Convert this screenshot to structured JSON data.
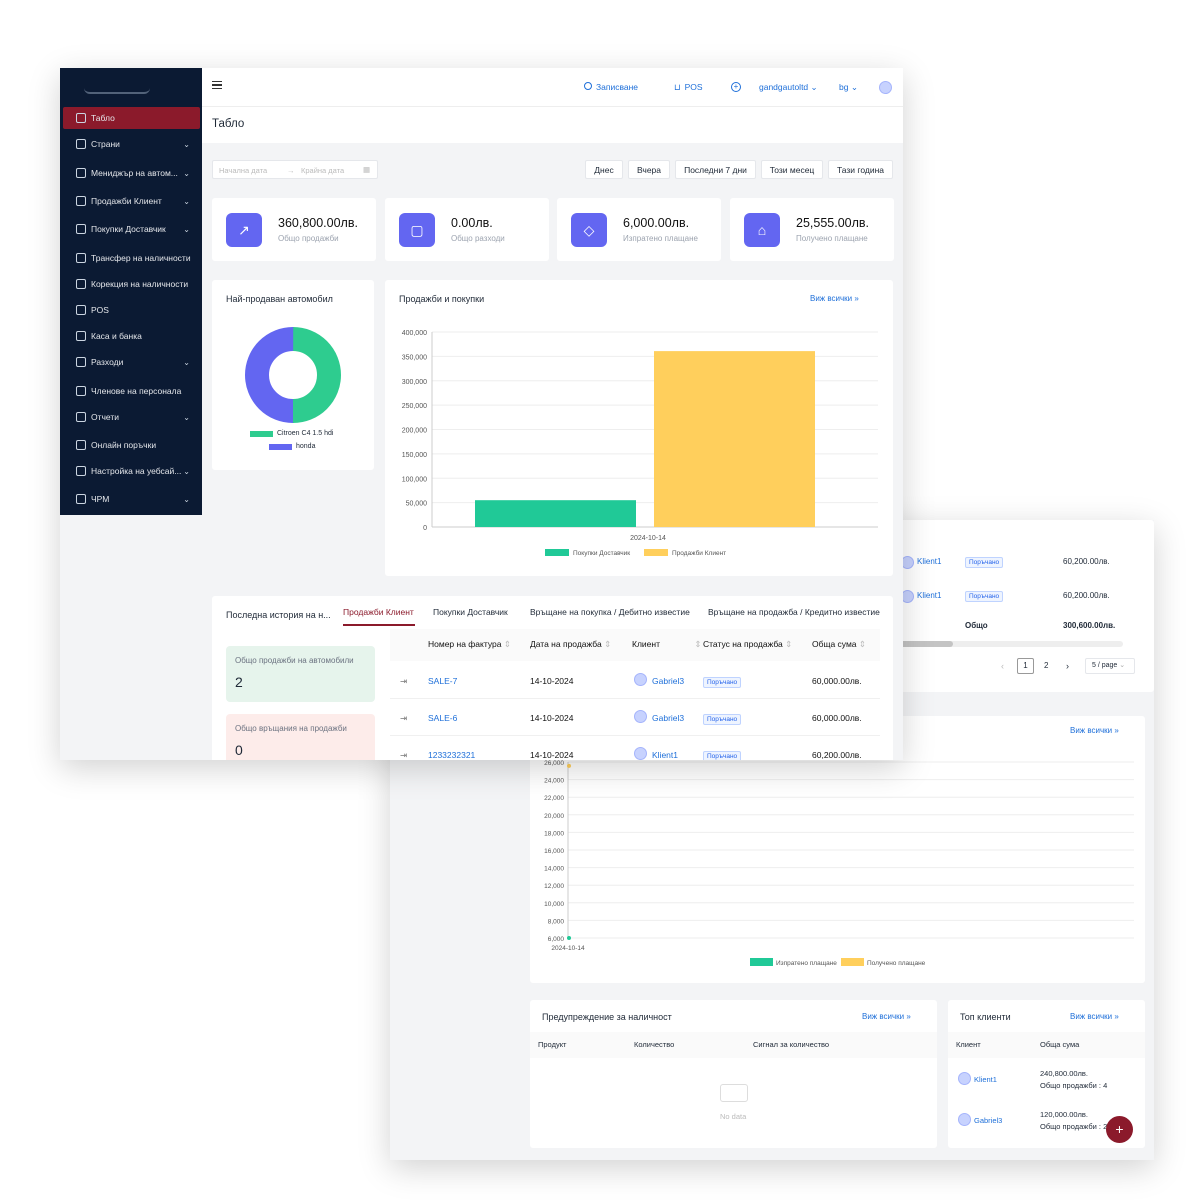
{
  "header": {
    "menu_icon": "hamburger-icon",
    "record_label": "Записване",
    "pos_label": "POS",
    "user_label": "gandgautoltd",
    "lang_label": "bg"
  },
  "page_title": "Табло",
  "sidebar": {
    "logo_icon": "car-logo-icon",
    "items": [
      {
        "label": "Табло",
        "icon": "home-icon",
        "chevron": false
      },
      {
        "label": "Страни",
        "icon": "users-icon",
        "chevron": true
      },
      {
        "label": "Мениджър на автом...",
        "icon": "grid-icon",
        "chevron": true
      },
      {
        "label": "Продажби Клиент",
        "icon": "receipt-icon",
        "chevron": true
      },
      {
        "label": "Покупки Доставчик",
        "icon": "bag-icon",
        "chevron": true
      },
      {
        "label": "Трансфер на наличности",
        "icon": "truck-icon",
        "chevron": false
      },
      {
        "label": "Корекция на наличности",
        "icon": "adjust-icon",
        "chevron": false
      },
      {
        "label": "POS",
        "icon": "monitor-icon",
        "chevron": false
      },
      {
        "label": "Каса и банка",
        "icon": "bank-icon",
        "chevron": false
      },
      {
        "label": "Разходи",
        "icon": "wallet-icon",
        "chevron": true
      },
      {
        "label": "Членове на персонала",
        "icon": "person-icon",
        "chevron": false
      },
      {
        "label": "Отчети",
        "icon": "chart-icon",
        "chevron": true
      },
      {
        "label": "Онлайн поръчки",
        "icon": "cart-icon",
        "chevron": false
      },
      {
        "label": "Настройка на уебсай...",
        "icon": "settings-icon",
        "chevron": true
      },
      {
        "label": "ЧРМ",
        "icon": "crm-icon",
        "chevron": true
      }
    ]
  },
  "date_filter": {
    "start_placeholder": "Начална дата",
    "end_placeholder": "Крайна дата",
    "buttons": [
      "Днес",
      "Вчера",
      "Последни 7 дни",
      "Този месец",
      "Тази година"
    ]
  },
  "stats": [
    {
      "value": "360,800.00лв.",
      "label": "Общо продажби",
      "icon": "line-chart-icon"
    },
    {
      "value": "0.00лв.",
      "label": "Общо разходи",
      "icon": "shopping-bag-icon"
    },
    {
      "value": "6,000.00лв.",
      "label": "Изпратено плащане",
      "icon": "tag-icon"
    },
    {
      "value": "25,555.00лв.",
      "label": "Получено плащане",
      "icon": "bank-icon"
    }
  ],
  "best_car": {
    "title": "Най-продаван автомобил",
    "legend": [
      {
        "name": "Citroen C4 1.5 hdi",
        "color": "#2ecc8f"
      },
      {
        "name": "honda",
        "color": "#6366f1"
      }
    ],
    "chart_data": {
      "type": "pie",
      "categories": [
        "Citroen C4 1.5 hdi",
        "honda"
      ],
      "values": [
        50,
        50
      ]
    }
  },
  "sales_purchases": {
    "title": "Продажби и покупки",
    "view_all": "Виж всички",
    "chart_data": {
      "type": "bar",
      "categories": [
        "2024-10-14"
      ],
      "series": [
        {
          "name": "Покупки Доставчик",
          "values": [
            55000
          ],
          "color": "#20c997"
        },
        {
          "name": "Продажби Клиент",
          "values": [
            360800
          ],
          "color": "#ffcf5c"
        }
      ],
      "yticks": [
        "400,000",
        "350,000",
        "300,000",
        "250,000",
        "200,000",
        "150,000",
        "100,000",
        "50,000",
        "0"
      ],
      "ylim": [
        0,
        400000
      ]
    }
  },
  "history": {
    "title": "Последна история на н...",
    "tabs": [
      "Продажби Клиент",
      "Покупки Доставчик",
      "Връщане на покупка / Дебитно известие",
      "Връщане на продажба / Кредитно известие"
    ],
    "summary": [
      {
        "label": "Общо продажби на автомобили",
        "value": "2"
      },
      {
        "label": "Общо връщания на продажби",
        "value": "0"
      }
    ],
    "columns": [
      "Номер на фактура",
      "Дата на продажба",
      "Клиент",
      "Статус на продажба",
      "Обща сума"
    ],
    "rows": [
      {
        "invoice": "SALE-7",
        "date": "14-10-2024",
        "client": "Gabriel3",
        "status": "Поръчано",
        "total": "60,000.00лв."
      },
      {
        "invoice": "SALE-6",
        "date": "14-10-2024",
        "client": "Gabriel3",
        "status": "Поръчано",
        "total": "60,000.00лв."
      },
      {
        "invoice": "1233232321",
        "date": "14-10-2024",
        "client": "Klient1",
        "status": "Поръчано",
        "total": "60,200.00лв."
      }
    ]
  },
  "back_table": {
    "rows": [
      {
        "client": "Klient1",
        "status": "Поръчано",
        "total": "60,200.00лв."
      },
      {
        "client": "Klient1",
        "status": "Поръчано",
        "total": "60,200.00лв."
      }
    ],
    "total_label": "Общо",
    "total_value": "300,600.00лв.",
    "pages": [
      "1",
      "2"
    ],
    "page_size": "5 / page"
  },
  "payments": {
    "view_all": "Виж всички",
    "chart_data": {
      "type": "line",
      "x": [
        "2024-10-14"
      ],
      "series": [
        {
          "name": "Изпратено плащане",
          "values": [
            6000
          ],
          "color": "#20c997"
        },
        {
          "name": "Получено плащане",
          "values": [
            25555
          ],
          "color": "#ffcf5c"
        }
      ],
      "yticks": [
        "26,000",
        "24,000",
        "22,000",
        "20,000",
        "18,000",
        "16,000",
        "14,000",
        "12,000",
        "10,000",
        "8,000",
        "6,000"
      ],
      "ylim": [
        6000,
        26000
      ]
    }
  },
  "stock_alert": {
    "title": "Предупреждение за наличност",
    "view_all": "Виж всички",
    "columns": [
      "Продукт",
      "Количество",
      "Сигнал за количество"
    ],
    "empty": "No data"
  },
  "top_clients": {
    "title": "Топ клиенти",
    "view_all": "Виж всички",
    "columns": [
      "Клиент",
      "Обща сума"
    ],
    "rows": [
      {
        "name": "Klient1",
        "total": "240,800.00лв.",
        "sales": "Общо продажби : 4"
      },
      {
        "name": "Gabriel3",
        "total": "120,000.00лв.",
        "sales": "Общо продажби : 2"
      }
    ]
  }
}
